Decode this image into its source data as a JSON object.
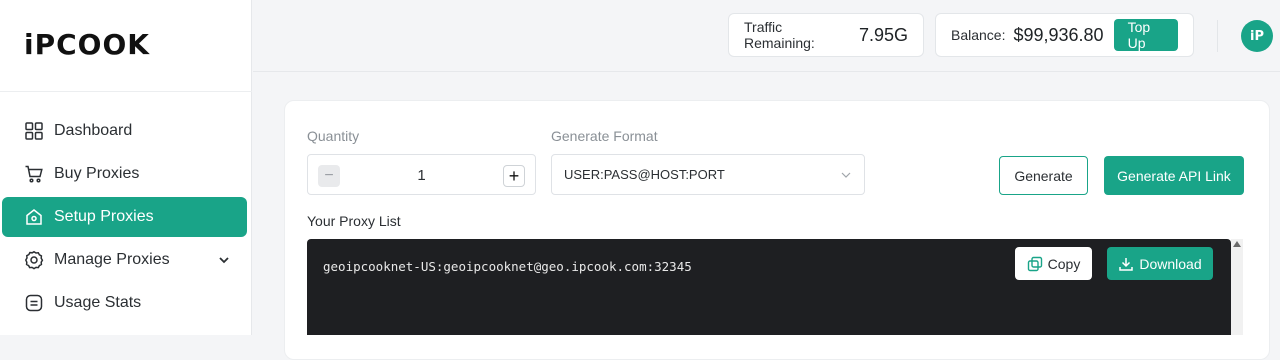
{
  "brand": {
    "logo_text": "iPCOOK",
    "accent": "#19a488"
  },
  "sidebar": {
    "items": [
      {
        "label": "Dashboard",
        "icon": "grid-icon",
        "active": false
      },
      {
        "label": "Buy Proxies",
        "icon": "cart-icon",
        "active": false
      },
      {
        "label": "Setup Proxies",
        "icon": "home-icon",
        "active": true
      },
      {
        "label": "Manage Proxies",
        "icon": "gear-icon",
        "active": false,
        "expandable": true
      },
      {
        "label": "Usage Stats",
        "icon": "list-icon",
        "active": false
      }
    ]
  },
  "header": {
    "traffic_label": "Traffic Remaining:",
    "traffic_value": "7.95G",
    "balance_label": "Balance:",
    "balance_value": "$99,936.80",
    "topup_label": "Top Up",
    "avatar_text": "iP"
  },
  "form": {
    "quantity_label": "Quantity",
    "quantity_value": "1",
    "minus": "−",
    "plus": "+",
    "format_label": "Generate Format",
    "format_value": "USER:PASS@HOST:PORT",
    "generate_label": "Generate",
    "api_link_label": "Generate API Link"
  },
  "proxy_list": {
    "label": "Your Proxy List",
    "lines": [
      "geoipcooknet-US:geoipcooknet@geo.ipcook.com:32345"
    ],
    "copy_label": "Copy",
    "download_label": "Download"
  }
}
